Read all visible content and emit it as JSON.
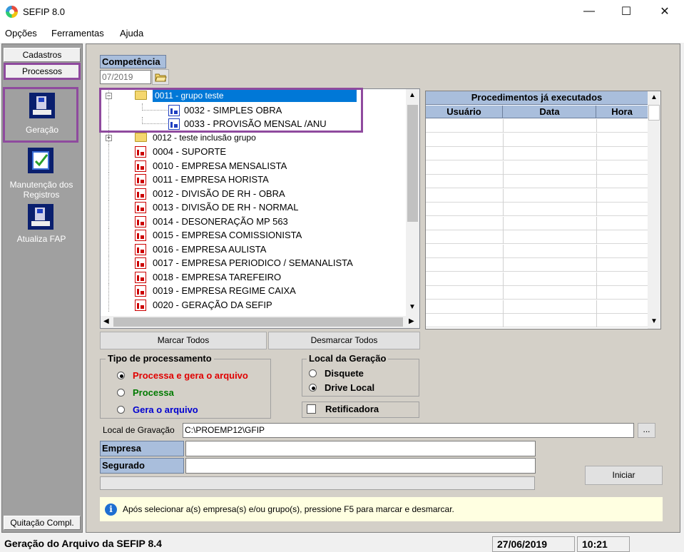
{
  "window": {
    "title": "SEFIP 8.0",
    "minimize": "—",
    "maximize": "☐",
    "close": "✕"
  },
  "menu": [
    "Opções",
    "Ferramentas",
    "Ajuda"
  ],
  "nav": {
    "tabs": [
      "Cadastros",
      "Processos"
    ],
    "items": [
      "Geração",
      "Manutenção dos Registros",
      "Atualiza FAP"
    ],
    "bottom": "Quitação Compl."
  },
  "competencia": {
    "label": "Competência",
    "value": "07/2019"
  },
  "tree": [
    {
      "label": "0011 - grupo teste",
      "type": "group",
      "expanded": true
    },
    {
      "label": "0032 - SIMPLES OBRA",
      "type": "child"
    },
    {
      "label": "0033 - PROVISÃO MENSAL /ANU",
      "type": "child"
    },
    {
      "label": "0012 - teste inclusão grupo",
      "type": "group"
    },
    {
      "label": "0004 - SUPORTE",
      "type": "company"
    },
    {
      "label": "0010 - EMPRESA MENSALISTA",
      "type": "company"
    },
    {
      "label": "0011 - EMPRESA HORISTA",
      "type": "company"
    },
    {
      "label": "0012 - DIVISÃO DE RH - OBRA",
      "type": "company"
    },
    {
      "label": "0013 - DIVISÃO DE RH - NORMAL",
      "type": "company"
    },
    {
      "label": "0014 - DESONERAÇÃO MP 563",
      "type": "company"
    },
    {
      "label": "0015 - EMPRESA COMISSIONISTA",
      "type": "company"
    },
    {
      "label": "0016 - EMPRESA AULISTA",
      "type": "company"
    },
    {
      "label": "0017 - EMPRESA PERIODICO / SEMANALISTA",
      "type": "company"
    },
    {
      "label": "0018 - EMPRESA TAREFEIRO",
      "type": "company"
    },
    {
      "label": "0019 - EMPRESA REGIME CAIXA",
      "type": "company"
    },
    {
      "label": "0020 - GERAÇÃO DA SEFIP",
      "type": "company"
    }
  ],
  "grid": {
    "title": "Procedimentos já executados",
    "columns": [
      "Usuário",
      "Data",
      "Hora"
    ]
  },
  "buttons": {
    "mark_all": "Marcar Todos",
    "unmark_all": "Desmarcar Todos",
    "browse": "...",
    "start": "Iniciar"
  },
  "tipo": {
    "title": "Tipo de processamento",
    "options": [
      {
        "label": "Processa e gera o arquivo",
        "color": "#e00000",
        "checked": true
      },
      {
        "label": "Processa",
        "color": "#007a00",
        "checked": false
      },
      {
        "label": "Gera o arquivo",
        "color": "#0000d0",
        "checked": false
      }
    ]
  },
  "local": {
    "title": "Local da Geração",
    "options": [
      {
        "label": "Disquete",
        "checked": false
      },
      {
        "label": "Drive Local",
        "checked": true
      }
    ]
  },
  "retificadora": "Retificadora",
  "gravacao": {
    "label": "Local de Gravação",
    "value": "C:\\PROEMP12\\GFIP"
  },
  "empresa": {
    "label": "Empresa",
    "value": ""
  },
  "segurado": {
    "label": "Segurado",
    "value": ""
  },
  "info": "Após selecionar a(s) empresa(s) e/ou grupo(s), pressione F5 para marcar e desmarcar.",
  "status": {
    "text": "Geração do Arquivo da SEFIP 8.4",
    "date": "27/06/2019",
    "time": "10:21"
  }
}
